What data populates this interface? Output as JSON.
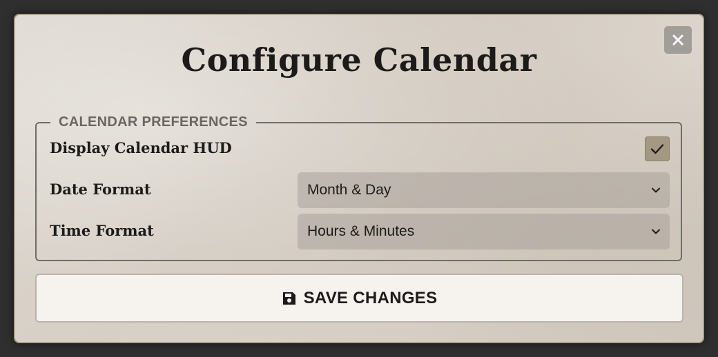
{
  "dialog": {
    "title": "Configure Calendar",
    "close_icon": "close-icon"
  },
  "preferences": {
    "legend": "CALENDAR PREFERENCES",
    "display_hud": {
      "label": "Display Calendar HUD",
      "checked": true,
      "icon": "checkmark-icon"
    },
    "date_format": {
      "label": "Date Format",
      "selected": "Month & Day",
      "icon": "chevron-down-icon"
    },
    "time_format": {
      "label": "Time Format",
      "selected": "Hours & Minutes",
      "icon": "chevron-down-icon"
    }
  },
  "save_button": {
    "label": "SAVE CHANGES",
    "icon": "save-icon"
  },
  "colors": {
    "page_background": "#2f2f2f",
    "checkbox_fill": "#a39881",
    "text": "#1d1b19",
    "legend_text": "#6b6661",
    "close_button": "#a19d98"
  }
}
